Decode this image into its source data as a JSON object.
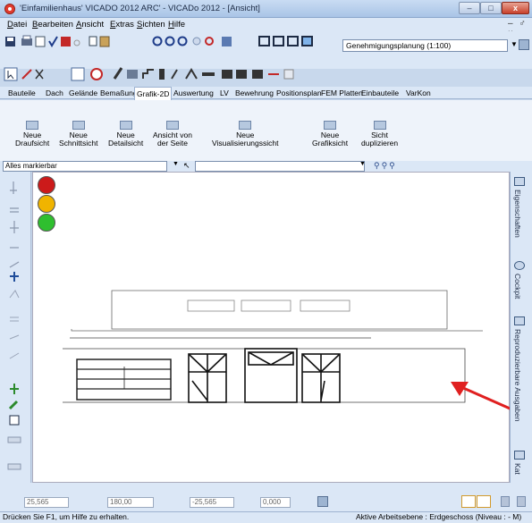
{
  "window": {
    "title": "'Einfamilienhaus' VICADO 2012 ARC' - VICADo 2012 - [Ansicht]",
    "min_label": "–",
    "max_label": "□",
    "close_label": "x"
  },
  "menu": {
    "items": [
      "Datei",
      "Bearbeiten",
      "Ansicht",
      "Extras",
      "Sichten",
      "Hilfe"
    ],
    "mdi_controls": "– ♂ ×"
  },
  "toolbar": {
    "profile_value": "Genehmigungsplanung (1:100)"
  },
  "tabs": [
    "Bauteile",
    "Dach",
    "Gelände",
    "Bemaßung",
    "Grafik-2D",
    "Auswertung",
    "LV",
    "Bewehrung",
    "Positionsplan",
    "FEM Platten",
    "Einbauteile",
    "VarKon"
  ],
  "active_tab": "Grafik-2D",
  "ribbon": {
    "buttons": [
      {
        "line1": "Neue",
        "line2": "Draufsicht"
      },
      {
        "line1": "Neue",
        "line2": "Schnittsicht"
      },
      {
        "line1": "Neue",
        "line2": "Detailsicht"
      },
      {
        "line1": "Ansicht von",
        "line2": "der Seite"
      },
      {
        "line1": "Neue",
        "line2": "Visualisierungssicht"
      },
      {
        "line1": "Neue",
        "line2": "Grafiksicht"
      },
      {
        "line1": "Sicht",
        "line2": "duplizieren"
      }
    ]
  },
  "selection": {
    "filter_value": "Alles markierbar"
  },
  "right_panel": {
    "tabs": [
      "Eigenschaften",
      "Cockpit",
      "Reproduzierbare Ausgaben",
      "Kat"
    ]
  },
  "coordinates": {
    "x": "25,565",
    "angle": "180,00",
    "y": "-25,565",
    "z": "0,000"
  },
  "status": {
    "help_text": "Drücken Sie F1, um Hilfe zu erhalten.",
    "layer_text": "Aktive Arbeitsebene : Erdgeschoss (Niveau : - M)"
  },
  "colors": {
    "light_red": "#cc1a1a",
    "light_yellow": "#f0b400",
    "light_green": "#2fbf2f",
    "annotation_arrow": "#e02020"
  }
}
